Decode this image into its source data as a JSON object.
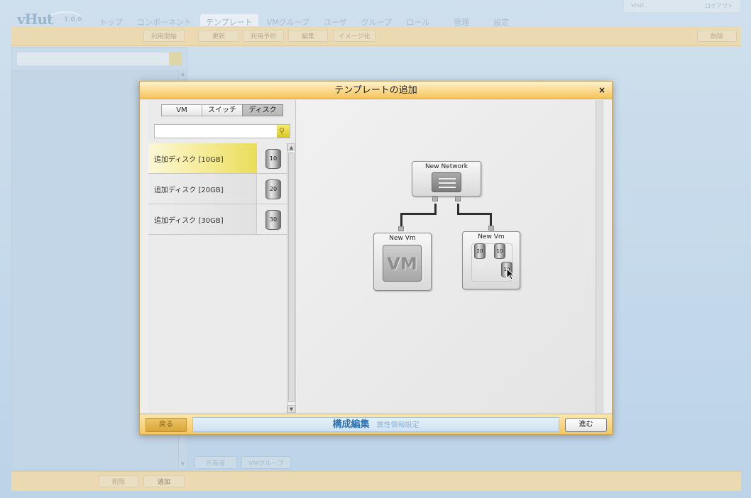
{
  "app": {
    "logo": "vHut",
    "version": "1.0.0",
    "user_name": "vhut",
    "logout_label": "ログアウト"
  },
  "nav": {
    "items": [
      "トップ",
      "コンポーネント",
      "テンプレート",
      "VMグループ",
      "ユーザ",
      "グループ",
      "ロール",
      "管理",
      "設定"
    ],
    "active": "テンプレート"
  },
  "toolbar": {
    "buttons": [
      "利用開始",
      "更新",
      "利用予約",
      "編集",
      "イメージ化"
    ],
    "right_button": "削除"
  },
  "left_panel": {
    "bottom_buttons": [
      "所有者",
      "VMグループ"
    ]
  },
  "footer_buttons": [
    "削除",
    "追加"
  ],
  "dialog": {
    "title": "テンプレートの追加",
    "close_glyph": "×",
    "tabs": [
      "VM",
      "スイッチ",
      "ディスク"
    ],
    "active_tab": "ディスク",
    "search_placeholder": "",
    "palette_items": [
      {
        "label": "追加ディスク [10GB]",
        "size": "10"
      },
      {
        "label": "追加ディスク [20GB]",
        "size": "20"
      },
      {
        "label": "追加ディスク [30GB]",
        "size": "30"
      }
    ],
    "canvas": {
      "network_node": {
        "title": "New Network"
      },
      "vm_nodes": [
        {
          "title": "New Vm",
          "icon_text": "VM"
        },
        {
          "title": "New Vm",
          "icon_text": "VM",
          "disks": [
            "20",
            "10",
            "10"
          ]
        }
      ]
    },
    "footer": {
      "back_label": "戻る",
      "step_current": "構成編集",
      "step_next": "属性情報設定",
      "next_label": "進む"
    }
  },
  "colors": {
    "title_bar": "#fbd98a",
    "footer_bar": "#f6c65f",
    "selected_item": "#f4e98c",
    "step_text": "#2d73b0",
    "background": "#c3d8ea"
  }
}
